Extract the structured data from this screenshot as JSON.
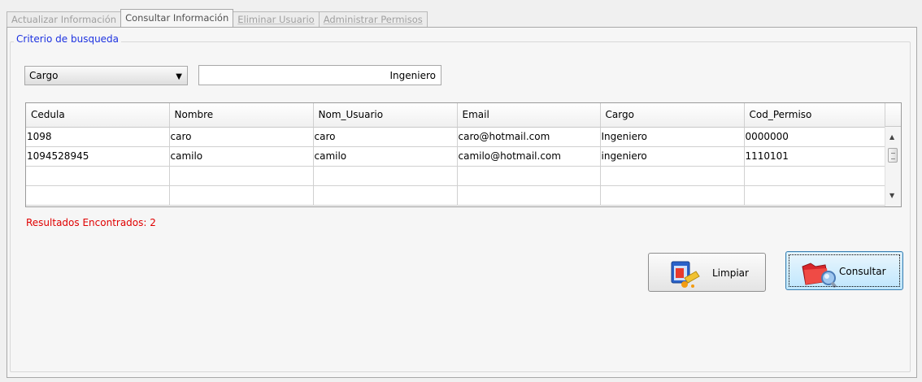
{
  "tabs": [
    {
      "label": "Actualizar Información",
      "state": "inactive"
    },
    {
      "label": "Consultar Información",
      "state": "active"
    },
    {
      "label": "Eliminar Usuario",
      "state": "disabled"
    },
    {
      "label": "Administrar Permisos",
      "state": "disabled"
    }
  ],
  "criteria": {
    "legend": "Criterio de busqueda",
    "combo_value": "Cargo",
    "search_value": "Ingeniero"
  },
  "grid": {
    "columns": [
      "Cedula",
      "Nombre",
      "Nom_Usuario",
      "Email",
      "Cargo",
      "Cod_Permiso"
    ],
    "rows": [
      [
        "1098",
        "caro",
        "caro",
        "caro@hotmail.com",
        "Ingeniero",
        "0000000"
      ],
      [
        "1094528945",
        "camilo",
        "camilo",
        "camilo@hotmail.com",
        "ingeniero",
        "1110101"
      ],
      [
        "",
        "",
        "",
        "",
        "",
        ""
      ],
      [
        "",
        "",
        "",
        "",
        "",
        ""
      ]
    ]
  },
  "results_text": "Resultados Encontrados: 2",
  "buttons": {
    "limpiar": {
      "label": "Limpiar",
      "icon": "eraser-window-icon"
    },
    "consultar": {
      "label": "Consultar",
      "icon": "folder-search-icon"
    }
  },
  "colors": {
    "legend": "#1d32e0",
    "results": "#e00000",
    "focus_button": "#bee6fd"
  }
}
